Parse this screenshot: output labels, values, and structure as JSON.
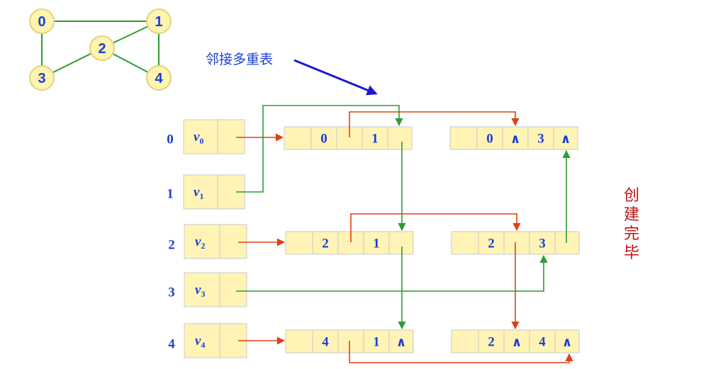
{
  "graph": {
    "nodes": [
      "0",
      "1",
      "2",
      "3",
      "4"
    ]
  },
  "title": "邻接多重表",
  "done_chars": [
    "创",
    "建",
    "完",
    "毕"
  ],
  "rows": [
    {
      "index": "0",
      "vertex": "v",
      "sub": "0"
    },
    {
      "index": "1",
      "vertex": "v",
      "sub": "1"
    },
    {
      "index": "2",
      "vertex": "v",
      "sub": "2"
    },
    {
      "index": "3",
      "vertex": "v",
      "sub": "3"
    },
    {
      "index": "4",
      "vertex": "v",
      "sub": "4"
    }
  ],
  "edges": [
    {
      "ivex": "0",
      "jvex": "1",
      "jlink": ""
    },
    {
      "ivex": "0",
      "ilink": "∧",
      "jvex": "3",
      "jlink": "∧"
    },
    {
      "ivex": "2",
      "jvex": "1",
      "jlink": ""
    },
    {
      "ivex": "2",
      "jvex": "3",
      "jlink": ""
    },
    {
      "ivex": "4",
      "jvex": "1",
      "jlink": "∧"
    },
    {
      "ivex": "2",
      "ilink": "∧",
      "jvex": "4",
      "jlink": "∧"
    }
  ],
  "colors": {
    "vertex_text": "#1a3fd8",
    "cell_fill": "#fff4b6",
    "green_arrow": "#2e9c2e",
    "red_arrow": "#e04010",
    "blue_arrow": "#1a1ad0",
    "done_text": "#c01010"
  }
}
